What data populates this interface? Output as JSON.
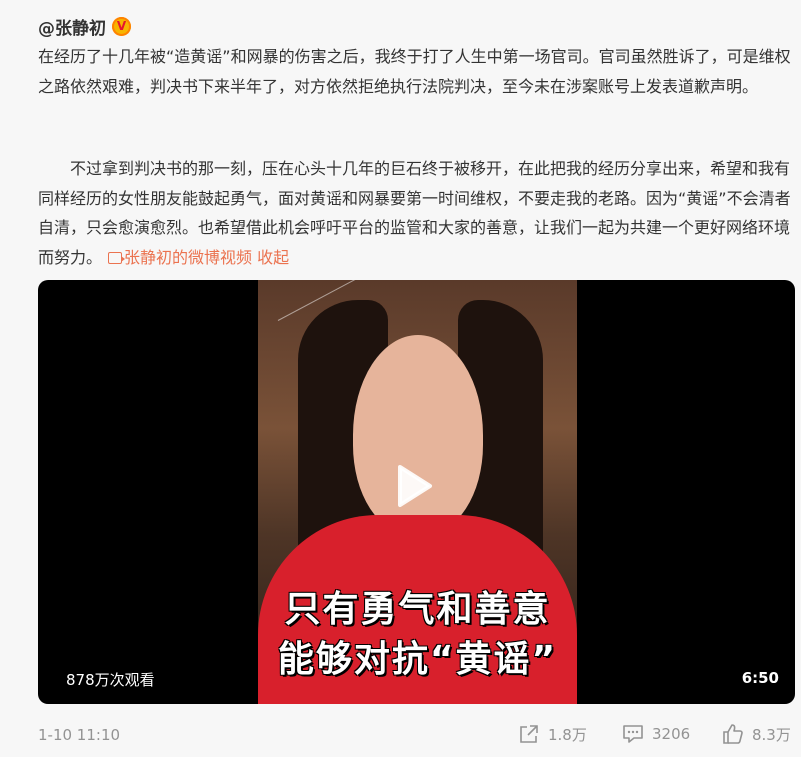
{
  "post": {
    "author": "@张静初",
    "badge": "V",
    "p1": "在经历了十几年被“造黄谣”和网暴的伤害之后，我终于打了人生中第一场官司。官司虽然胜诉了，可是维权之路依然艰难，判决书下来半年了，对方依然拒绝执行法院判决，至今未在涉案账号上发表道歉声明。",
    "p2": "不过拿到判决书的那一刻，压在心头十几年的巨石终于被移开，在此把我的经历分享出来，希望和我有同样经历的女性朋友能鼓起勇气，面对黄谣和网暴要第一时间维权，不要走我的老路。因为“黄谣”不会清者自清，只会愈演愈烈。也希望借此机会呼吁平台的监管和大家的善意，让我们一起为共建一个更好网络环境而努力。",
    "video_link": "张静初的微博视频",
    "collapse": "收起",
    "video_icon": "video-icon",
    "link_color": "#eb7350"
  },
  "video": {
    "overlay_line1": "只有勇气和善意",
    "overlay_line2": "能够对抗“黄谣”",
    "views": "878万次观看",
    "duration": "6:50",
    "play_icon": "play-icon"
  },
  "footer": {
    "time": "1-10 11:10",
    "share": "1.8万",
    "comments": "3206",
    "likes": "8.3万",
    "share_icon": "share-icon",
    "comment_icon": "comment-icon",
    "like_icon": "thumbs-up-icon"
  }
}
